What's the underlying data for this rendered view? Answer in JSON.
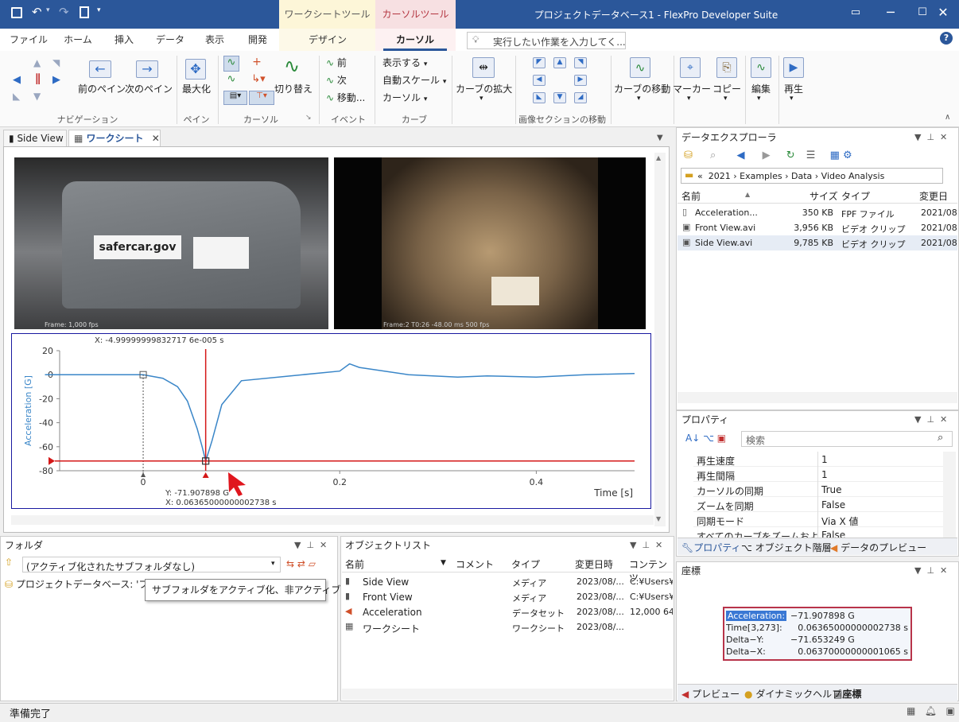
{
  "qat": {
    "save": "save-icon",
    "undo": "undo-icon",
    "redo": "redo-icon",
    "new": "new-doc-icon"
  },
  "context": {
    "worksheet_tools": "ワークシートツール",
    "cursor_tools": "カーソルツール"
  },
  "app_title": "プロジェクトデータベース1 - FlexPro Developer Suite",
  "tabs": [
    "ファイル",
    "ホーム",
    "挿入",
    "データ",
    "表示",
    "開発",
    "デザイン",
    "カーソル"
  ],
  "tell_me": "実行したい作業を入力してく...",
  "ribbon": {
    "nav_prev_pane": "前のペイン",
    "nav_next_pane": "次のペイン",
    "nav_group": "ナビゲーション",
    "maximize": "最大化",
    "pane_group": "ペイン",
    "switch": "切り替え",
    "cursor_group": "カーソル",
    "ev_prev": "前",
    "ev_next": "次",
    "ev_move": "移動...",
    "event_group": "イベント",
    "show": "表示する",
    "autoscale": "自動スケール",
    "cursor_dd": "カーソル",
    "curve_group": "カーブ",
    "curve_zoom": "カーブの拡大",
    "imgsec_group": "画像セクションの移動",
    "curve_move": "カーブの移動",
    "marker": "マーカー",
    "copy": "コピー",
    "edit": "編集",
    "play": "再生"
  },
  "doc_tabs": {
    "side": "Side View",
    "ws": "ワークシート"
  },
  "video": {
    "left_frame": "Frame:",
    "left_fps": "1,000 fps",
    "right_info": "Frame:2  T0:26  -48.00 ms  500 fps"
  },
  "chart_data": {
    "type": "line",
    "ylabel": "Acceleration [G]",
    "xlabel": "Time [s]",
    "ylim": [
      -80,
      20
    ],
    "xlim": [
      -0.085,
      0.5
    ],
    "yticks": [
      "20",
      "0",
      "-20",
      "-40",
      "-60",
      "-80"
    ],
    "xticks": [
      "0",
      "0.2",
      "0.4"
    ],
    "cursor_x_top": "X: -4.99999999832717 6e-005 s",
    "cursor_y": "Y: -71.907898 G",
    "cursor_x": "X: 0.06365000000002738 s",
    "x": [
      -0.1,
      0.0,
      0.02,
      0.035,
      0.045,
      0.055,
      0.06,
      0.0636,
      0.07,
      0.08,
      0.1,
      0.15,
      0.2,
      0.21,
      0.22,
      0.27,
      0.32,
      0.35,
      0.4,
      0.45,
      0.5
    ],
    "values": [
      0,
      0,
      -3,
      -10,
      -22,
      -45,
      -60,
      -72,
      -55,
      -25,
      -5,
      -1,
      3,
      9,
      6,
      0,
      -2,
      -1,
      -2,
      0,
      1
    ]
  },
  "explorer": {
    "title": "データエクスプローラ",
    "breadcrumb": [
      "«",
      "2021",
      "Examples",
      "Data",
      "Video Analysis"
    ],
    "cols": [
      "名前",
      "サイズ",
      "タイプ",
      "変更日"
    ],
    "rows": [
      {
        "name": "Acceleration...",
        "size": "350 KB",
        "type": "FPF ファイル",
        "date": "2021/08/"
      },
      {
        "name": "Front View.avi",
        "size": "3,956 KB",
        "type": "ビデオ クリップ",
        "date": "2021/08/"
      },
      {
        "name": "Side View.avi",
        "size": "9,785 KB",
        "type": "ビデオ クリップ",
        "date": "2021/08/"
      }
    ]
  },
  "properties": {
    "title": "プロパティ",
    "search": "検索",
    "rows": [
      {
        "k": "再生速度",
        "v": "1"
      },
      {
        "k": "再生間隔",
        "v": "1"
      },
      {
        "k": "カーソルの同期",
        "v": "True"
      },
      {
        "k": "ズームを同期",
        "v": "False"
      },
      {
        "k": "同期モード",
        "v": "Via X 値"
      },
      {
        "k": "すべてのカーブをズームおよ...",
        "v": "False"
      }
    ],
    "tabs": [
      "プロパティ",
      "オブジェクト階層",
      "データのプレビュー"
    ]
  },
  "coords": {
    "title": "座標",
    "rows": [
      {
        "k": "Acceleration:",
        "v": "−71.907898 G"
      },
      {
        "k": "Time[3,273]:",
        "v": "0.06365000000002738 s"
      },
      {
        "k": "Delta−Y:",
        "v": "−71.653249 G"
      },
      {
        "k": "Delta−X:",
        "v": "0.06370000000001065 s"
      }
    ],
    "tabs": [
      "プレビュー",
      "ダイナミックヘルプ",
      "座標"
    ]
  },
  "folder": {
    "title": "フォルダ",
    "combo": "(アクティブ化されたサブフォルダなし)",
    "tree_item": "プロジェクトデータベース: 'プロジェク",
    "tooltip": "サブフォルダをアクティブ化、非アクティブ化"
  },
  "objlist": {
    "title": "オブジェクトリスト",
    "cols": [
      "名前",
      "コメント",
      "タイプ",
      "変更日時",
      "コンテンツ"
    ],
    "rows": [
      {
        "name": "Side View",
        "type": "メディア",
        "date": "2023/08/...",
        "content": "C:¥Users¥"
      },
      {
        "name": "Front View",
        "type": "メディア",
        "date": "2023/08/...",
        "content": "C:¥Users¥"
      },
      {
        "name": "Acceleration",
        "type": "データセット",
        "date": "2023/08/...",
        "content": "12,000 64"
      },
      {
        "name": "ワークシート",
        "type": "ワークシート",
        "date": "2023/08/...",
        "content": ""
      }
    ]
  },
  "status": "準備完了"
}
